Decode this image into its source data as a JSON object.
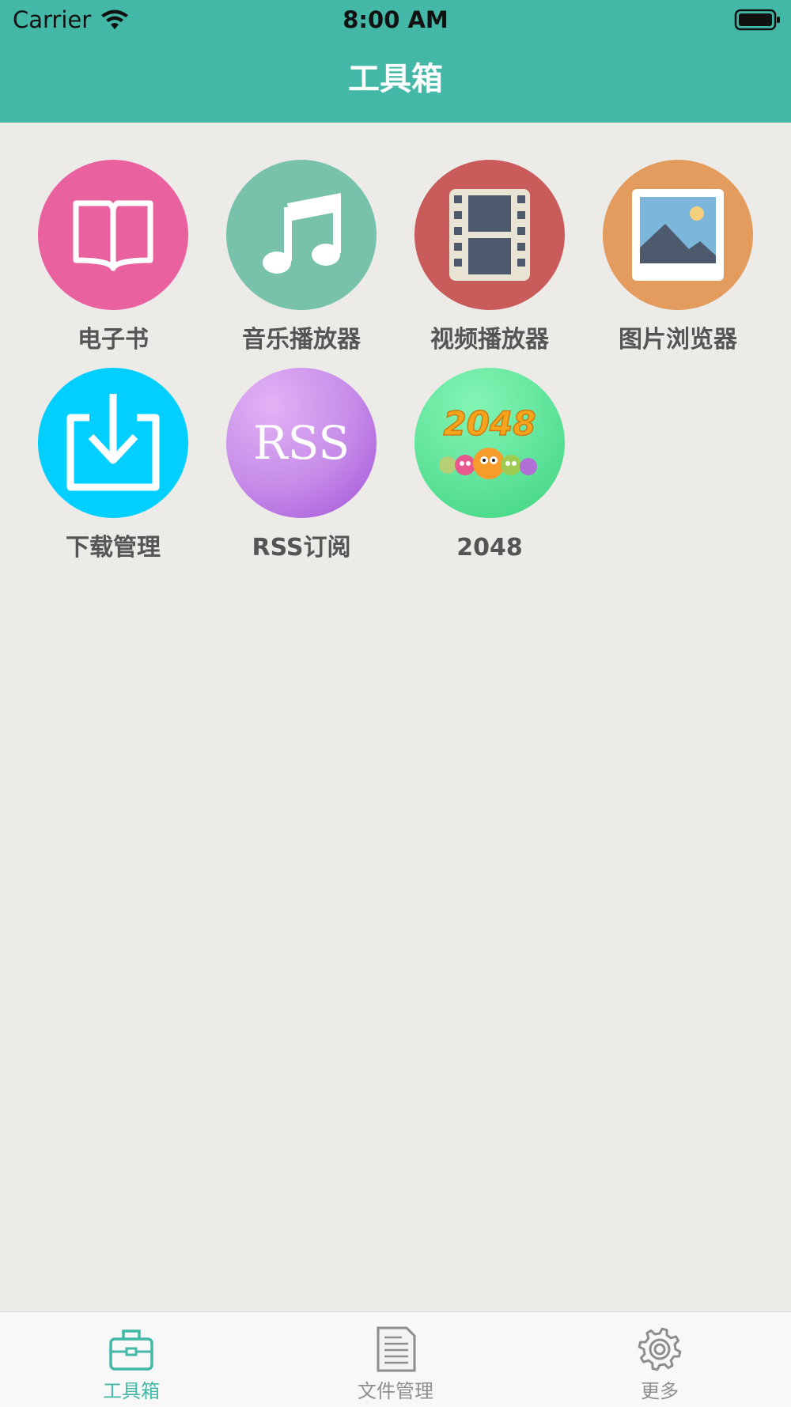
{
  "status_bar": {
    "carrier": "Carrier",
    "time": "8:00 AM"
  },
  "nav": {
    "title": "工具箱"
  },
  "tools": [
    {
      "label": "电子书",
      "icon": "book-icon",
      "color": "#e9619f"
    },
    {
      "label": "音乐播放器",
      "icon": "music-note-icon",
      "color": "#78c2ac"
    },
    {
      "label": "视频播放器",
      "icon": "film-icon",
      "color": "#c95b5b"
    },
    {
      "label": "图片浏览器",
      "icon": "picture-icon",
      "color": "#e39b5e"
    },
    {
      "label": "下载管理",
      "icon": "download-icon",
      "color": "#00cfff"
    },
    {
      "label": "RSS订阅",
      "icon": "rss-icon",
      "text": "RSS",
      "color": "#c98ae8"
    },
    {
      "label": "2048",
      "icon": "game-2048-icon",
      "text": "2048",
      "color": "#5fe39a"
    }
  ],
  "tabbar": {
    "active": 0,
    "items": [
      {
        "label": "工具箱",
        "icon": "toolbox-icon"
      },
      {
        "label": "文件管理",
        "icon": "document-icon"
      },
      {
        "label": "更多",
        "icon": "gear-icon"
      }
    ]
  },
  "colors": {
    "header": "#43b8a6",
    "background": "#ecebe8",
    "active_tab": "#43b8a6",
    "inactive_tab": "#8e8e8e"
  }
}
